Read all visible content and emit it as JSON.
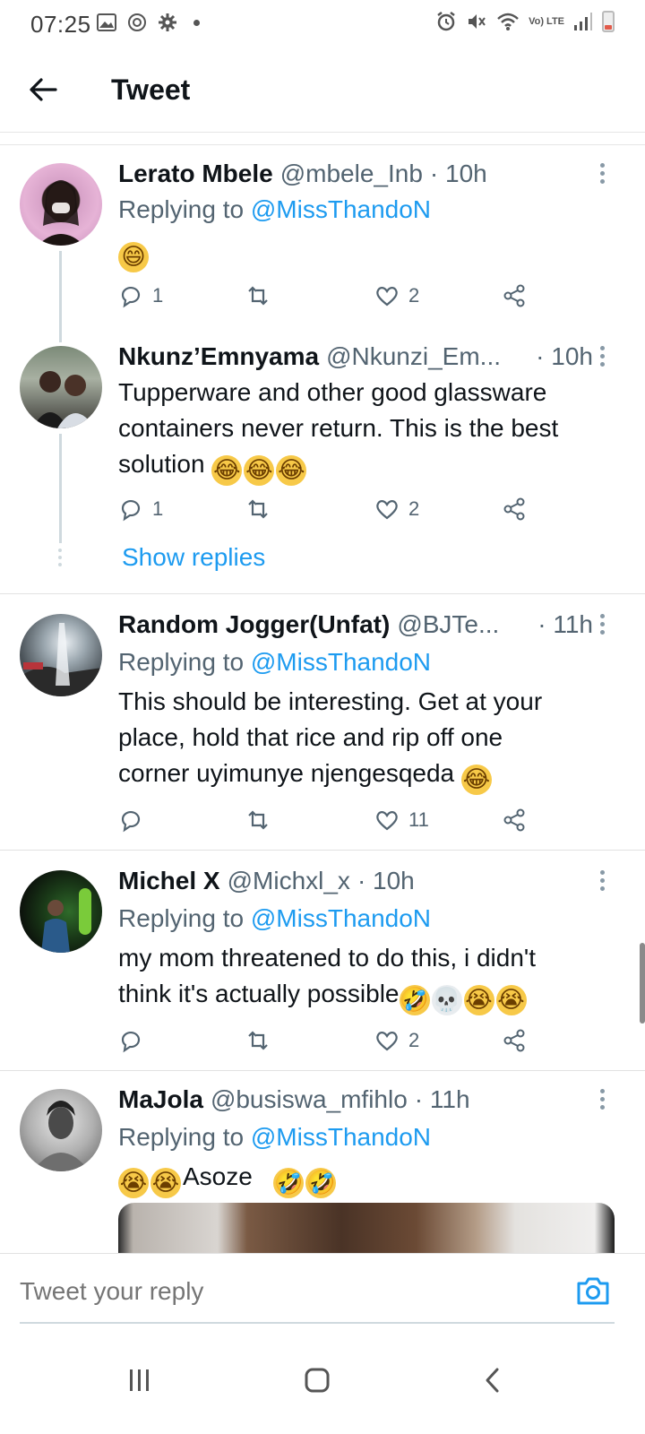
{
  "status_bar": {
    "time": "07:25",
    "network": "Vo) LTE"
  },
  "header": {
    "title": "Tweet"
  },
  "tweets": [
    {
      "name": "Lerato Mbele",
      "handle": "@mbele_Inb",
      "time": "· 10h",
      "replying_prefix": "Replying to ",
      "replying_to": "@MissThandoN",
      "text": "",
      "emojis": [
        "😄"
      ],
      "replies": "1",
      "retweets": "",
      "likes": "2"
    },
    {
      "name": "Nkunz’Emnyama",
      "handle": "@Nkunzi_Em...",
      "time": "· 10h",
      "text_lines": [
        "Tupperware and other good glassware",
        "containers never return. This is the best",
        "solution"
      ],
      "emojis": [
        "😂",
        "😂",
        "😂"
      ],
      "replies": "1",
      "retweets": "",
      "likes": "2",
      "show_replies": "Show replies"
    },
    {
      "name": "Random Jogger(Unfat)",
      "handle": "@BJTe...",
      "time": "· 11h",
      "replying_prefix": "Replying to ",
      "replying_to": "@MissThandoN",
      "text_lines": [
        "This should be interesting. Get at your",
        "place, hold that rice and rip off one",
        "corner uyimunye njengesqeda"
      ],
      "emojis": [
        "😂"
      ],
      "replies": "",
      "retweets": "",
      "likes": "11"
    },
    {
      "name": "Michel X",
      "handle": "@Michxl_x",
      "time": "· 10h",
      "replying_prefix": "Replying to ",
      "replying_to": "@MissThandoN",
      "text_lines": [
        "my mom threatened to do this, i didn't",
        "think it's actually possible"
      ],
      "emojis": [
        "🤣",
        "💀",
        "😭",
        "😭"
      ],
      "replies": "",
      "retweets": "",
      "likes": "2"
    },
    {
      "name": "MaJola",
      "handle": "@busiswa_mfihlo",
      "time": "· 11h",
      "replying_prefix": "Replying to ",
      "replying_to": "@MissThandoN",
      "text": "Asoze",
      "emojis_before": [
        "😭",
        "😭"
      ],
      "emojis_after": [
        "🤣",
        "🤣"
      ]
    }
  ],
  "reply_bar": {
    "placeholder": "Tweet your reply"
  },
  "icons": {
    "back": "arrow-left-icon",
    "more": "more-vertical-icon",
    "reply": "reply-icon",
    "retweet": "retweet-icon",
    "like": "heart-icon",
    "share": "share-icon",
    "camera": "camera-icon",
    "nav_recents": "recents-icon",
    "nav_home": "home-icon",
    "nav_back": "nav-back-icon"
  },
  "colors": {
    "accent": "#1d9bf0",
    "secondary_text": "#536471",
    "primary_text": "#0f1419"
  }
}
